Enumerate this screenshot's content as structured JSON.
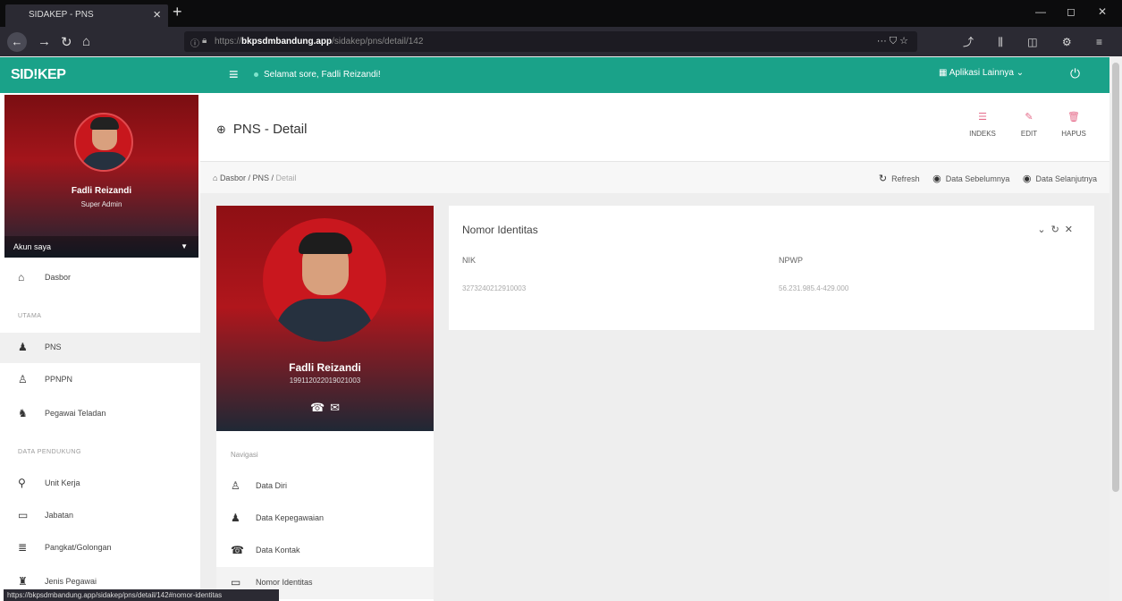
{
  "browser": {
    "tab_title": "SIDAKEP - PNS",
    "url_scheme": "https://",
    "url_host": "bkpsdmbandung.app",
    "url_path": "/sidakep/pns/detail/142",
    "status_url": "https://bkpsdmbandung.app/sidakep/pns/detail/142#nomor-identitas"
  },
  "app": {
    "brand": "SID!KEP",
    "greeting": "Selamat sore, Fadli Reizandi!",
    "apps_label": "Aplikasi Lainnya"
  },
  "sidebar": {
    "user_name": "Fadli Reizandi",
    "user_role": "Super Admin",
    "account_label": "Akun saya",
    "dashboard": "Dasbor",
    "section_main": "UTAMA",
    "items_main": [
      "PNS",
      "PPNPN",
      "Pegawai Teladan"
    ],
    "section_ref": "DATA PENDUKUNG",
    "items_ref": [
      "Unit Kerja",
      "Jabatan",
      "Pangkat/Golongan",
      "Jenis Pegawai"
    ]
  },
  "page": {
    "title": "PNS - Detail",
    "buttons": {
      "index": "INDEKS",
      "edit": "EDIT",
      "delete": "HAPUS"
    },
    "breadcrumb": {
      "home": "Dasbor",
      "section": "PNS",
      "current": "Detail"
    },
    "actions": {
      "refresh": "Refresh",
      "prev": "Data Sebelumnya",
      "next": "Data Selanjutnya"
    }
  },
  "profile": {
    "name": "Fadli Reizandi",
    "nip": "199112022019021003"
  },
  "navigation": {
    "heading": "Navigasi",
    "items": [
      "Data Diri",
      "Data Kepegawaian",
      "Data Kontak",
      "Nomor Identitas"
    ]
  },
  "identity": {
    "title": "Nomor Identitas",
    "nik_label": "NIK",
    "nik_value": "3273240212910003",
    "npwp_label": "NPWP",
    "npwp_value": "56.231.985.4-429.000"
  },
  "colors": {
    "primary": "#1aa289",
    "accent_pink": "#e56b8a"
  }
}
